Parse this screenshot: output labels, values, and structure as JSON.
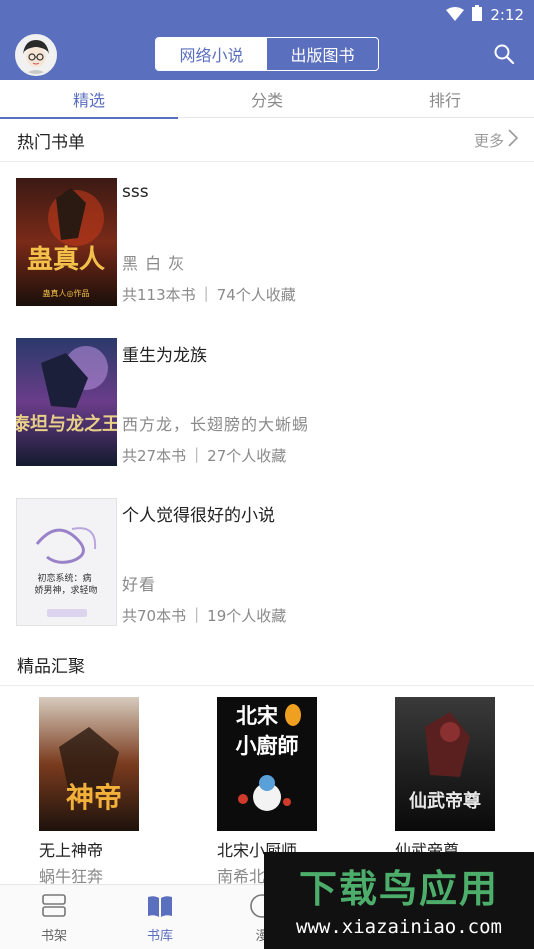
{
  "status_bar": {
    "time": "2:12",
    "wifi_icon": "wifi-icon",
    "battery_icon": "battery-icon"
  },
  "header": {
    "segments": [
      {
        "label": "网络小说",
        "active": true
      },
      {
        "label": "出版图书",
        "active": false
      }
    ],
    "avatar_icon": "avatar-icon",
    "search_icon": "search-icon"
  },
  "tabs": [
    {
      "label": "精选",
      "active": true
    },
    {
      "label": "分类",
      "active": false
    },
    {
      "label": "排行",
      "active": false
    }
  ],
  "hot_lists": {
    "title": "热门书单",
    "more_label": "更多",
    "items": [
      {
        "title": "sss",
        "desc": "黑 白 灰",
        "count": "共113本书",
        "favorites": "74个人收藏",
        "cover_text": "蛊真人",
        "cover_sub": "蛊真人◎作品"
      },
      {
        "title": "重生为龙族",
        "desc": "西方龙，长翅膀的大蜥蜴",
        "count": "共27本书",
        "favorites": "27个人收藏",
        "cover_text": "泰坦与龙之王",
        "cover_sub": ""
      },
      {
        "title": "个人觉得很好的小说",
        "desc": "好看",
        "count": "共70本书",
        "favorites": "19个人收藏",
        "cover_text": "初恋系统：病娇男神，求轻吻",
        "cover_sub": ""
      }
    ]
  },
  "featured": {
    "title": "精品汇聚",
    "items": [
      {
        "title": "无上神帝",
        "author": "蜗牛狂奔",
        "cover_text": "神帝"
      },
      {
        "title": "北宋小厨师",
        "author": "南希北",
        "cover_text": "北宋小廚師"
      },
      {
        "title": "仙武帝尊",
        "author": "",
        "cover_text": "仙武帝尊"
      }
    ]
  },
  "bottom_nav": [
    {
      "label": "书架",
      "icon": "bookshelf-icon",
      "active": false
    },
    {
      "label": "书库",
      "icon": "book-open-icon",
      "active": true
    },
    {
      "label": "漫",
      "icon": "comic-icon",
      "active": false
    }
  ],
  "watermark": {
    "text": "下载鸟应用",
    "url": "www.xiazainiao.com"
  },
  "colors": {
    "primary": "#5b6fbf",
    "text": "#222222",
    "muted": "#8a8a8a"
  }
}
